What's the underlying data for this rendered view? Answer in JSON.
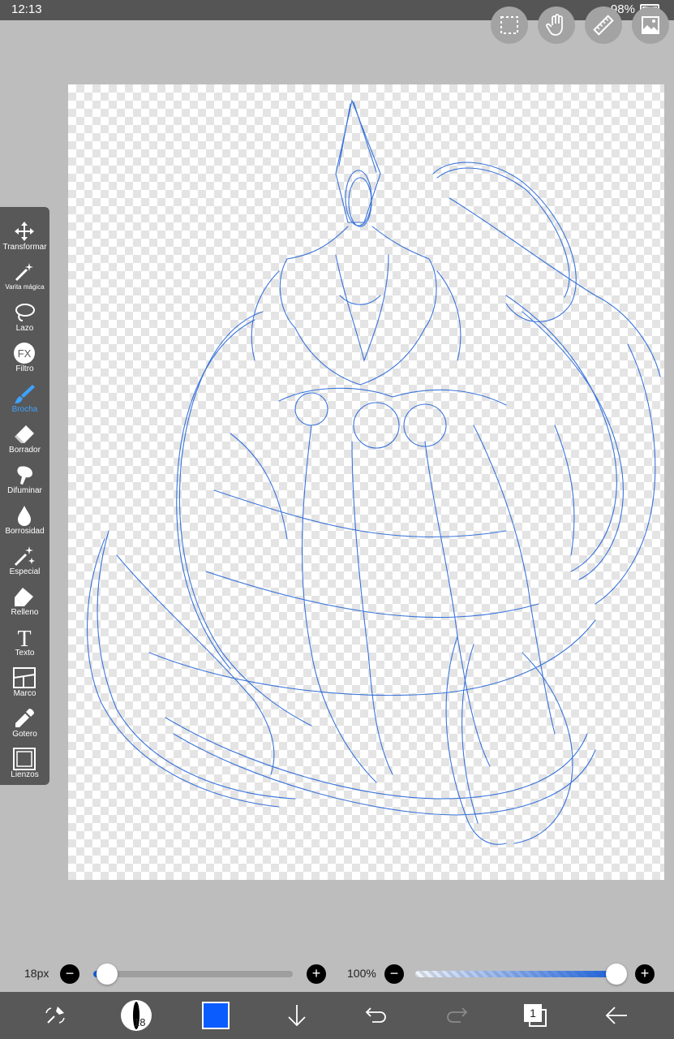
{
  "status": {
    "time": "12:13",
    "battery": "98%"
  },
  "top_actions": [
    {
      "name": "selection-icon"
    },
    {
      "name": "hand-icon"
    },
    {
      "name": "ruler-icon"
    },
    {
      "name": "gallery-icon"
    }
  ],
  "tools": [
    {
      "name": "transform",
      "label": "Transformar",
      "icon": "move-icon"
    },
    {
      "name": "magic-wand",
      "label": "Varita mágica",
      "icon": "magic-wand-icon"
    },
    {
      "name": "lasso",
      "label": "Lazo",
      "icon": "lasso-icon"
    },
    {
      "name": "filter",
      "label": "Filtro",
      "icon": "fx-icon"
    },
    {
      "name": "brush",
      "label": "Brocha",
      "icon": "brush-icon",
      "active": true
    },
    {
      "name": "eraser",
      "label": "Borrador",
      "icon": "eraser-icon"
    },
    {
      "name": "smudge",
      "label": "Difuminar",
      "icon": "smudge-icon"
    },
    {
      "name": "blur",
      "label": "Borrosidad",
      "icon": "drop-icon"
    },
    {
      "name": "special",
      "label": "Especial",
      "icon": "sparkle-icon"
    },
    {
      "name": "fill",
      "label": "Relleno",
      "icon": "bucket-icon"
    },
    {
      "name": "text",
      "label": "Texto",
      "icon": "text-icon"
    },
    {
      "name": "frame",
      "label": "Marco",
      "icon": "frame-icon"
    },
    {
      "name": "eyedropper",
      "label": "Gotero",
      "icon": "eyedropper-icon"
    },
    {
      "name": "canvas",
      "label": "Lienzos",
      "icon": "canvas-icon"
    }
  ],
  "brush_size": {
    "label": "18px",
    "value_fraction": 0.03,
    "minus": "−",
    "plus": "+"
  },
  "opacity": {
    "label": "100%",
    "value_fraction": 1.0,
    "minus": "−",
    "plus": "+"
  },
  "bottom": {
    "brush_preview_value": "18",
    "layers_count": "1",
    "color": "#0a5cff"
  },
  "colors": {
    "stroke": "#1a5ed6",
    "accent": "#3da3ff",
    "panel": "#585858"
  }
}
